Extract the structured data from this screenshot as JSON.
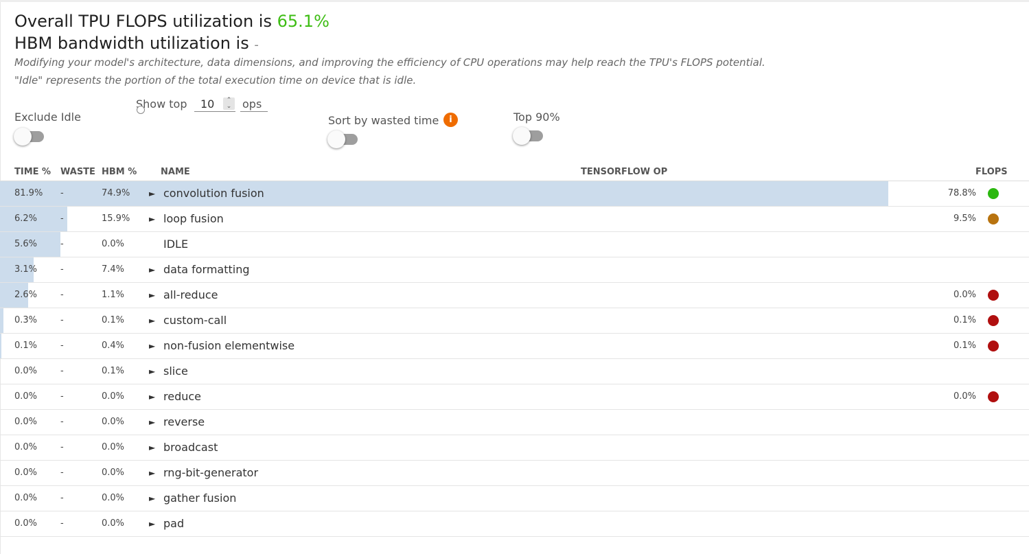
{
  "summary": {
    "flops_prefix": "Overall TPU FLOPS utilization is",
    "flops_value": "65.1%",
    "hbm_prefix": "HBM bandwidth utilization is",
    "hbm_value": "-",
    "description_1": "Modifying your model's architecture, data dimensions, and improving the efficiency of CPU operations may help reach the TPU's FLOPS potential.",
    "description_2": "\"Idle\" represents the portion of the total execution time on device that is idle."
  },
  "controls": {
    "exclude_idle_label": "Exclude Idle",
    "exclude_idle_on": false,
    "show_top_prefix": "Show top",
    "show_top_value": "10",
    "show_top_suffix": "ops",
    "sort_wasted_label": "Sort by wasted time",
    "sort_wasted_on": false,
    "top90_label": "Top 90%",
    "top90_on": false
  },
  "table": {
    "headers": {
      "time": "TIME %",
      "waste": "WASTE",
      "hbm": "HBM %",
      "name": "NAME",
      "tf_op": "TENSORFLOW OP",
      "flops": "FLOPS"
    },
    "colors": {
      "bar": "#ccdcec",
      "good": "#2bb80f",
      "medium": "#b8730f",
      "bad": "#b00f0f"
    },
    "rows": [
      {
        "time": "81.9%",
        "time_fraction": 0.819,
        "waste": "-",
        "hbm": "74.9%",
        "expandable": true,
        "name": "convolution fusion",
        "flops": "78.8%",
        "status": "good"
      },
      {
        "time": "6.2%",
        "time_fraction": 0.062,
        "waste": "-",
        "hbm": "15.9%",
        "expandable": true,
        "name": "loop fusion",
        "flops": "9.5%",
        "status": "medium"
      },
      {
        "time": "5.6%",
        "time_fraction": 0.056,
        "waste": "-",
        "hbm": "0.0%",
        "expandable": false,
        "name": "IDLE",
        "flops": "",
        "status": ""
      },
      {
        "time": "3.1%",
        "time_fraction": 0.031,
        "waste": "-",
        "hbm": "7.4%",
        "expandable": true,
        "name": "data formatting",
        "flops": "",
        "status": ""
      },
      {
        "time": "2.6%",
        "time_fraction": 0.026,
        "waste": "-",
        "hbm": "1.1%",
        "expandable": true,
        "name": "all-reduce",
        "flops": "0.0%",
        "status": "bad"
      },
      {
        "time": "0.3%",
        "time_fraction": 0.003,
        "waste": "-",
        "hbm": "0.1%",
        "expandable": true,
        "name": "custom-call",
        "flops": "0.1%",
        "status": "bad"
      },
      {
        "time": "0.1%",
        "time_fraction": 0.001,
        "waste": "-",
        "hbm": "0.4%",
        "expandable": true,
        "name": "non-fusion elementwise",
        "flops": "0.1%",
        "status": "bad"
      },
      {
        "time": "0.0%",
        "time_fraction": 0.0,
        "waste": "-",
        "hbm": "0.1%",
        "expandable": true,
        "name": "slice",
        "flops": "",
        "status": ""
      },
      {
        "time": "0.0%",
        "time_fraction": 0.0,
        "waste": "-",
        "hbm": "0.0%",
        "expandable": true,
        "name": "reduce",
        "flops": "0.0%",
        "status": "bad"
      },
      {
        "time": "0.0%",
        "time_fraction": 0.0,
        "waste": "-",
        "hbm": "0.0%",
        "expandable": true,
        "name": "reverse",
        "flops": "",
        "status": ""
      },
      {
        "time": "0.0%",
        "time_fraction": 0.0,
        "waste": "-",
        "hbm": "0.0%",
        "expandable": true,
        "name": "broadcast",
        "flops": "",
        "status": ""
      },
      {
        "time": "0.0%",
        "time_fraction": 0.0,
        "waste": "-",
        "hbm": "0.0%",
        "expandable": true,
        "name": "rng-bit-generator",
        "flops": "",
        "status": ""
      },
      {
        "time": "0.0%",
        "time_fraction": 0.0,
        "waste": "-",
        "hbm": "0.0%",
        "expandable": true,
        "name": "gather fusion",
        "flops": "",
        "status": ""
      },
      {
        "time": "0.0%",
        "time_fraction": 0.0,
        "waste": "-",
        "hbm": "0.0%",
        "expandable": true,
        "name": "pad",
        "flops": "",
        "status": ""
      }
    ]
  }
}
